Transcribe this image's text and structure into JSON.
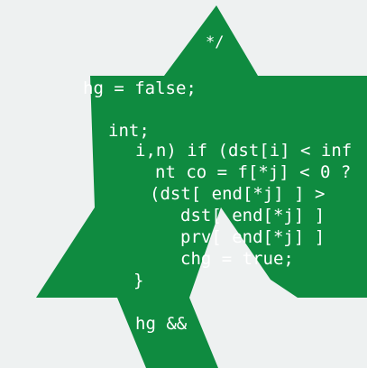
{
  "colors": {
    "background": "#eef1f1",
    "star": "#0f8b40",
    "text": "#ffffff"
  },
  "code": {
    "comment": "*/",
    "chg_false": "hg = false;",
    "nt": "int;",
    "if_line": "i,n) if (dst[i] < inf",
    "int_line": "nt co = f[*j] < 0 ?",
    "dst1": "(dst[ end[*j] ] >",
    "dst2": "dst[ end[*j] ]",
    "prv": "prv[ end[*j] ]",
    "chg_true": "chg = true;",
    "brace": "}",
    "hg": "hg &&"
  }
}
